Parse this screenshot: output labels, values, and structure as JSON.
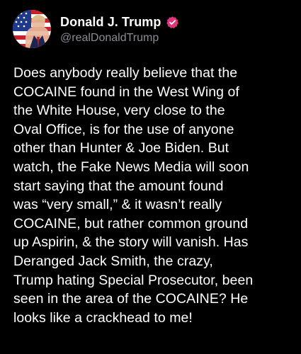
{
  "author": {
    "display_name": "Donald J. Trump",
    "handle": "@realDonaldTrump",
    "verified_icon": "verified-badge-icon",
    "avatar_icon": "profile-avatar"
  },
  "post": {
    "text": "Does anybody really believe that the\nCOCAINE found in the West Wing of\nthe White House, very close to the\nOval Office, is for the use of anyone\nother than Hunter & Joe Biden. But\nwatch, the Fake News Media will soon\nstart saying that the amount found\nwas “very small,” & it wasn’t really\nCOCAINE, but rather common ground\nup Aspirin, & the story will vanish. Has\nDeranged Jack Smith, the crazy,\nTrump hating Special Prosecutor, been\nseen in the area of the COCAINE? He\nlooks like a crackhead to me!"
  },
  "colors": {
    "background": "#000000",
    "text": "#ffffff",
    "handle": "#8b8b95",
    "verified_badge": "#e0357c"
  }
}
